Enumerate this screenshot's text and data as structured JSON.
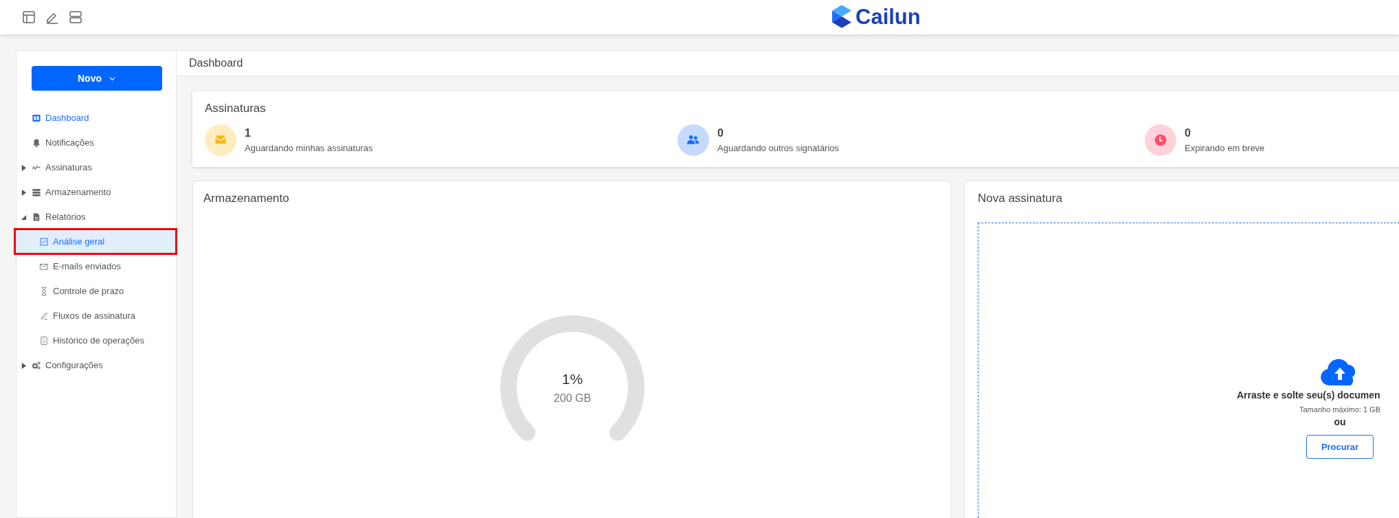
{
  "header": {
    "logo_text": "Cailun"
  },
  "sidebar": {
    "new_button": "Novo",
    "items": [
      {
        "label": "Dashboard",
        "selected": true
      },
      {
        "label": "Notificações",
        "selected": false
      },
      {
        "label": "Assinaturas",
        "selected": false,
        "expanded": false
      },
      {
        "label": "Armazenamento",
        "selected": false,
        "expanded": false
      },
      {
        "label": "Relatórios",
        "selected": false,
        "expanded": true,
        "children": [
          {
            "label": "Análise geral",
            "selected": true,
            "outlined": true
          },
          {
            "label": "E-mails enviados",
            "selected": false,
            "outlined": false
          },
          {
            "label": "Controle de prazo",
            "selected": false,
            "outlined": false
          },
          {
            "label": "Fluxos de assinatura",
            "selected": false,
            "outlined": false
          },
          {
            "label": "Histórico de operações",
            "selected": false,
            "outlined": false
          }
        ]
      },
      {
        "label": "Configurações",
        "selected": false,
        "expanded": false
      }
    ]
  },
  "page_title": "Dashboard",
  "signatures": {
    "title": "Assinaturas",
    "stats": [
      {
        "count": "1",
        "label": "Aguardando minhas assinaturas",
        "color": "#ffb800"
      },
      {
        "count": "0",
        "label": "Aguardando outros signatários",
        "color": "#1a6dff"
      },
      {
        "count": "0",
        "label": "Expirando em breve",
        "color": "#ff4d6a"
      }
    ]
  },
  "storage": {
    "title": "Armazenamento",
    "percent": "1%",
    "capacity": "200 GB"
  },
  "new_signature": {
    "title": "Nova assinatura",
    "headline": "Arraste e solte seu(s) documen",
    "max_size": "Tamanho máximo: 1 GB",
    "or": "ou",
    "browse_button": "Procurar"
  }
}
